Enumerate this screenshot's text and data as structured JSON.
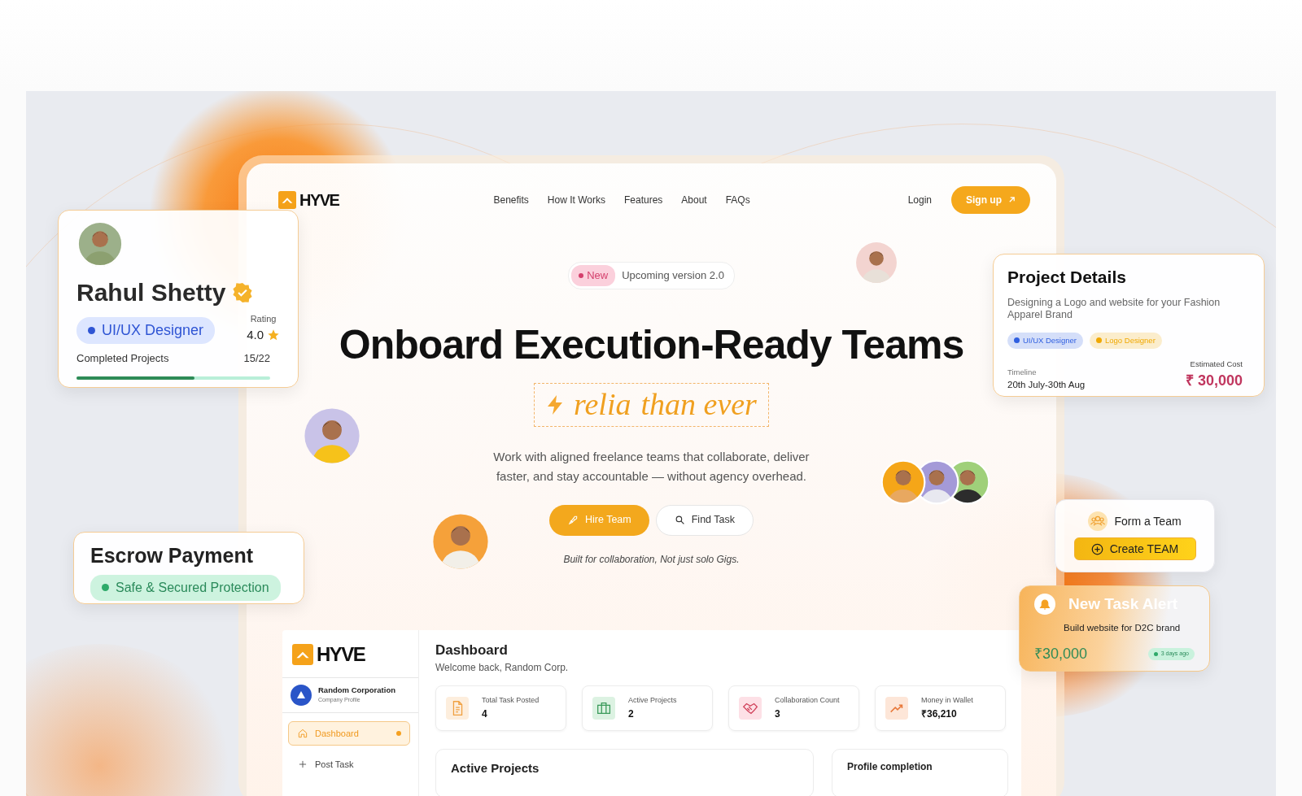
{
  "navbar": {
    "brand": "HYVE",
    "links": [
      "Benefits",
      "How It Works",
      "Features",
      "About",
      "FAQs"
    ],
    "login": "Login",
    "signup": "Sign up"
  },
  "hero": {
    "badge": "New",
    "announcement": "Upcoming version 2.0",
    "headline": "Onboard Execution-Ready Teams",
    "typed_word": "relia",
    "typed_rest": "than ever",
    "description": "Work with aligned freelance teams that collaborate, deliver faster, and stay accountable — without agency overhead.",
    "buttons": [
      {
        "label": "Hire Team",
        "kind": "primary"
      },
      {
        "label": "Find Task",
        "kind": "outline"
      }
    ],
    "tagline": "Built for collaboration, Not just solo Gigs."
  },
  "profile_card": {
    "name": "Rahul Shetty",
    "verified": true,
    "role": "UI/UX Designer",
    "rating_label": "Rating",
    "rating": "4.0",
    "projects_label": "Completed Projects",
    "projects_count": "15/22",
    "level": 0.61
  },
  "project_card": {
    "title": "Project Details",
    "description": "Designing a Logo and website for your Fashion Apparel Brand",
    "tags": [
      {
        "label": "UI/UX Designer",
        "color": "#2f5fe0"
      },
      {
        "label": "Logo Designer",
        "color": "#f0a800"
      }
    ],
    "timeline_label": "Timeline",
    "timeline": "20th July-30th Aug",
    "cost_label": "Estimated Cost",
    "cost": "₹ 30,000"
  },
  "escrow_card": {
    "title": "Escrow Payment",
    "badge": "Safe & Secured Protection"
  },
  "team_card": {
    "title": "Form a Team",
    "button": "Create TEAM"
  },
  "alert_card": {
    "title": "New Task Alert",
    "description": "Build website for D2C brand",
    "amount": "₹30,000",
    "time": "3 days ago"
  },
  "dashboard": {
    "brand": "HYVE",
    "company": "Random Corporation",
    "company_sub": "Company Profile",
    "nav": [
      {
        "label": "Dashboard",
        "kind": "home",
        "selected": true
      },
      {
        "label": "Post Task",
        "kind": "plus",
        "selected": false
      }
    ],
    "title": "Dashboard",
    "subtitle": "Welcome back, Random Corp.",
    "stats": [
      {
        "label": "Total Task Posted",
        "value": "4",
        "kind": "document"
      },
      {
        "label": "Active Projects",
        "value": "2",
        "kind": "briefcase"
      },
      {
        "label": "Collaboration Count",
        "value": "3",
        "kind": "handshake"
      },
      {
        "label": "Money in Wallet",
        "value": "₹36,210",
        "kind": "trend"
      }
    ],
    "panels": [
      "Active Projects",
      "Profile completion"
    ]
  }
}
